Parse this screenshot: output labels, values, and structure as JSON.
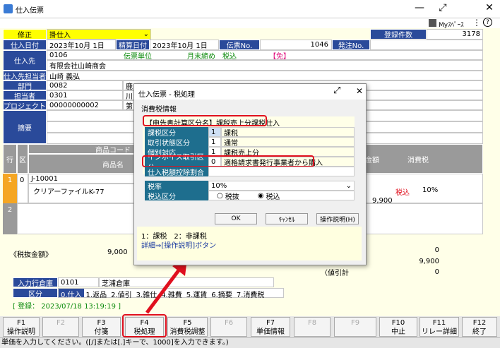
{
  "window": {
    "title": "仕入伝票",
    "myspace": "Myｽﾍﾟｰｽ"
  },
  "header": {
    "mode": "修正",
    "mode_value": "掛仕入",
    "count_label": "登録件数",
    "count_value": "3178",
    "date_label": "入日付",
    "date_value": "2023年10月 1日",
    "account_date_label": "精算日付",
    "account_date_value": "2023年10月 1日",
    "slip_label": "伝票No.",
    "slip_value": "1046",
    "order_label": "発注No.",
    "supplier_label": "仕入先",
    "supplier_code": "0106",
    "supplier_tax_unit": "伝票単位",
    "supplier_close": "月末締め",
    "supplier_tax": "税込",
    "supplier_mark": "【免】",
    "supplier_name": "有限会社山崎商会",
    "contact_label": "仕入先担当者",
    "contact_value": "山崎 義弘",
    "dept_label": "部門",
    "dept_code": "0082",
    "dept_name": "鹿",
    "staff_label": "担当者",
    "staff_code": "0301",
    "staff_name": "川",
    "project_label": "プロジェクト",
    "project_code": "00000000002",
    "project_name": "第",
    "memo_label": "摘要"
  },
  "grid": {
    "col_row": "行",
    "col_kbn": "区",
    "col_code": "商品コード",
    "col_name": "商品名",
    "col_amount": "金額",
    "col_tax": "消費税",
    "row1_no": "1",
    "row1_kbn": "0",
    "row1_code": "J-10001",
    "row1_name": "クリアーファイルK-77",
    "row1_tax_type": "税込",
    "row1_tax_rate": "10%",
    "row1_amount": "9,900",
    "row2_no": "2"
  },
  "summary": {
    "pretax_label": "《税抜金額》",
    "pretax_value": "9,000",
    "v1": "0",
    "v2": "9,900",
    "v3": "0",
    "balance_label": "〈値引計"
  },
  "warehouse": {
    "label": "入力行倉庫",
    "code": "0101",
    "name": "芝浦倉庫"
  },
  "kubun": {
    "label": "区分",
    "items": [
      "0.仕入",
      "1.返品",
      "2.値引",
      "3.雑仕",
      "4.雑費",
      "5.運賃",
      "6.摘要",
      "7.消費税"
    ]
  },
  "registered": "[ 登録： 2023/07/18 13:19:19 ]",
  "fkeys": [
    {
      "k": "F1",
      "l": "操作説明"
    },
    {
      "k": "F2",
      "l": ""
    },
    {
      "k": "F3",
      "l": "付箋"
    },
    {
      "k": "F4",
      "l": "税処理"
    },
    {
      "k": "F5",
      "l": "消費税調整"
    },
    {
      "k": "F6",
      "l": ""
    },
    {
      "k": "F7",
      "l": "単価情報"
    },
    {
      "k": "F8",
      "l": ""
    },
    {
      "k": "F9",
      "l": ""
    },
    {
      "k": "F10",
      "l": "中止"
    },
    {
      "k": "F11",
      "l": "リレー詳細"
    },
    {
      "k": "F12",
      "l": "終了"
    }
  ],
  "status": "単価を入力してください。([/]または[.]キーで、1000]を入力できます。)",
  "dialog": {
    "title": "仕入伝票 - 税処理",
    "section": "消費税情報",
    "calc_method": "【申告書計算区分名】課税売上分課税仕入",
    "rows": [
      {
        "label": "課税区分",
        "code": "1",
        "text": "課税"
      },
      {
        "label": "取引状態区分",
        "code": "1",
        "text": "通常"
      },
      {
        "label": "個別対応",
        "code": "1",
        "text": "課税売上分"
      },
      {
        "label": "インボイス取引区分",
        "code": "0",
        "text": "適格請求書発行事業者から購入"
      },
      {
        "label": "仕入税額控除割合",
        "code": "",
        "text": ""
      }
    ],
    "rate_label": "税率",
    "rate_value": "10%",
    "taxkbn_label": "税込区分",
    "opt_excl": "税抜",
    "opt_incl": "税込",
    "ok": "OK",
    "cancel": "ｷｬﾝｾﾙ",
    "help": "操作説明(H)",
    "hint1": "1：課税　2：非課税",
    "hint2": "詳細⇒[操作説明]ボタン"
  },
  "colors": {
    "label_bg": "#2a4a9a",
    "mode_bg": "#ffff00",
    "highlight": "#e0101e",
    "orange": "#f5a623"
  }
}
